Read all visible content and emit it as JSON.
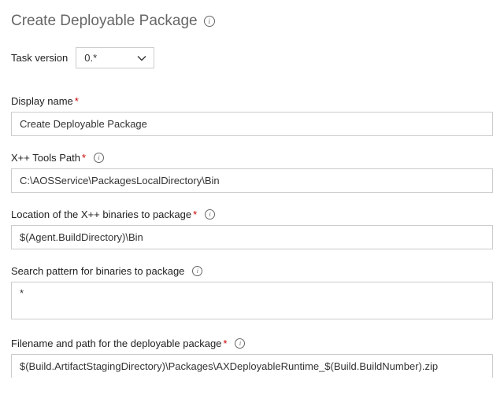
{
  "header": {
    "title": "Create Deployable Package"
  },
  "taskVersion": {
    "label": "Task version",
    "value": "0.*"
  },
  "fields": {
    "displayName": {
      "label": "Display name",
      "required": "*",
      "value": "Create Deployable Package"
    },
    "toolsPath": {
      "label": "X++ Tools Path",
      "required": "*",
      "value": "C:\\AOSService\\PackagesLocalDirectory\\Bin"
    },
    "binaries": {
      "label": "Location of the X++ binaries to package",
      "required": "*",
      "value": "$(Agent.BuildDirectory)\\Bin"
    },
    "pattern": {
      "label": "Search pattern for binaries to package",
      "value": "*"
    },
    "filename": {
      "label": "Filename and path for the deployable package",
      "required": "*",
      "value": "$(Build.ArtifactStagingDirectory)\\Packages\\AXDeployableRuntime_$(Build.BuildNumber).zip"
    }
  }
}
